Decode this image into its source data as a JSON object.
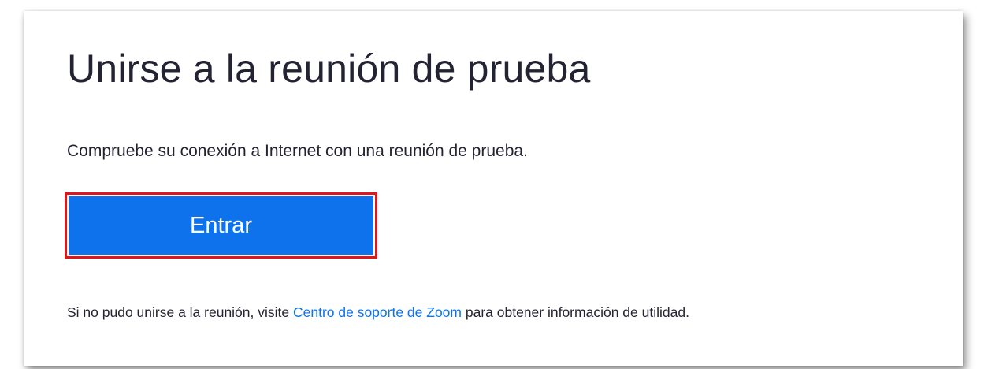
{
  "page": {
    "title": "Unirse a la reunión de prueba",
    "subtitle": "Compruebe su conexión a Internet con una reunión de prueba.",
    "join_button_label": "Entrar",
    "help_prefix": "Si no pudo unirse a la reunión, visite ",
    "help_link": "Centro de soporte de Zoom",
    "help_suffix": " para obtener información de utilidad."
  },
  "colors": {
    "button": "#0e72ed",
    "highlight_border": "#e0161e",
    "link": "#0e72ed",
    "text": "#232333"
  }
}
